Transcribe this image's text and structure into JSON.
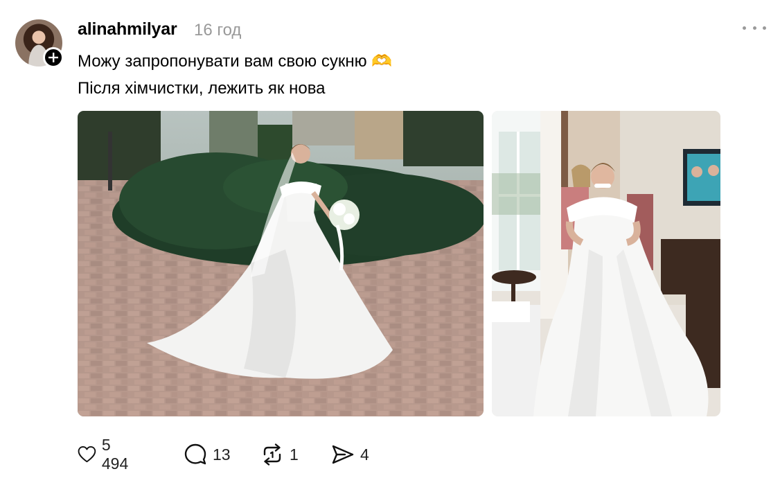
{
  "post": {
    "username": "alinahmilyar",
    "time": "16 год",
    "text_line1": "Можу запропонувати вам свою сукню 🫶",
    "text_line2": "Після хімчистки, лежить як нова"
  },
  "images": [
    {
      "description_icon": "photo-bride-outdoor"
    },
    {
      "description_icon": "photo-bride-indoor"
    }
  ],
  "actions": {
    "likes": "5 494",
    "replies": "13",
    "reposts": "1",
    "shares": "4"
  },
  "icons": {
    "like": "heart-icon",
    "reply": "comment-icon",
    "repost": "repost-icon",
    "share": "send-icon",
    "more": "more-dots-icon",
    "follow": "plus-icon"
  }
}
